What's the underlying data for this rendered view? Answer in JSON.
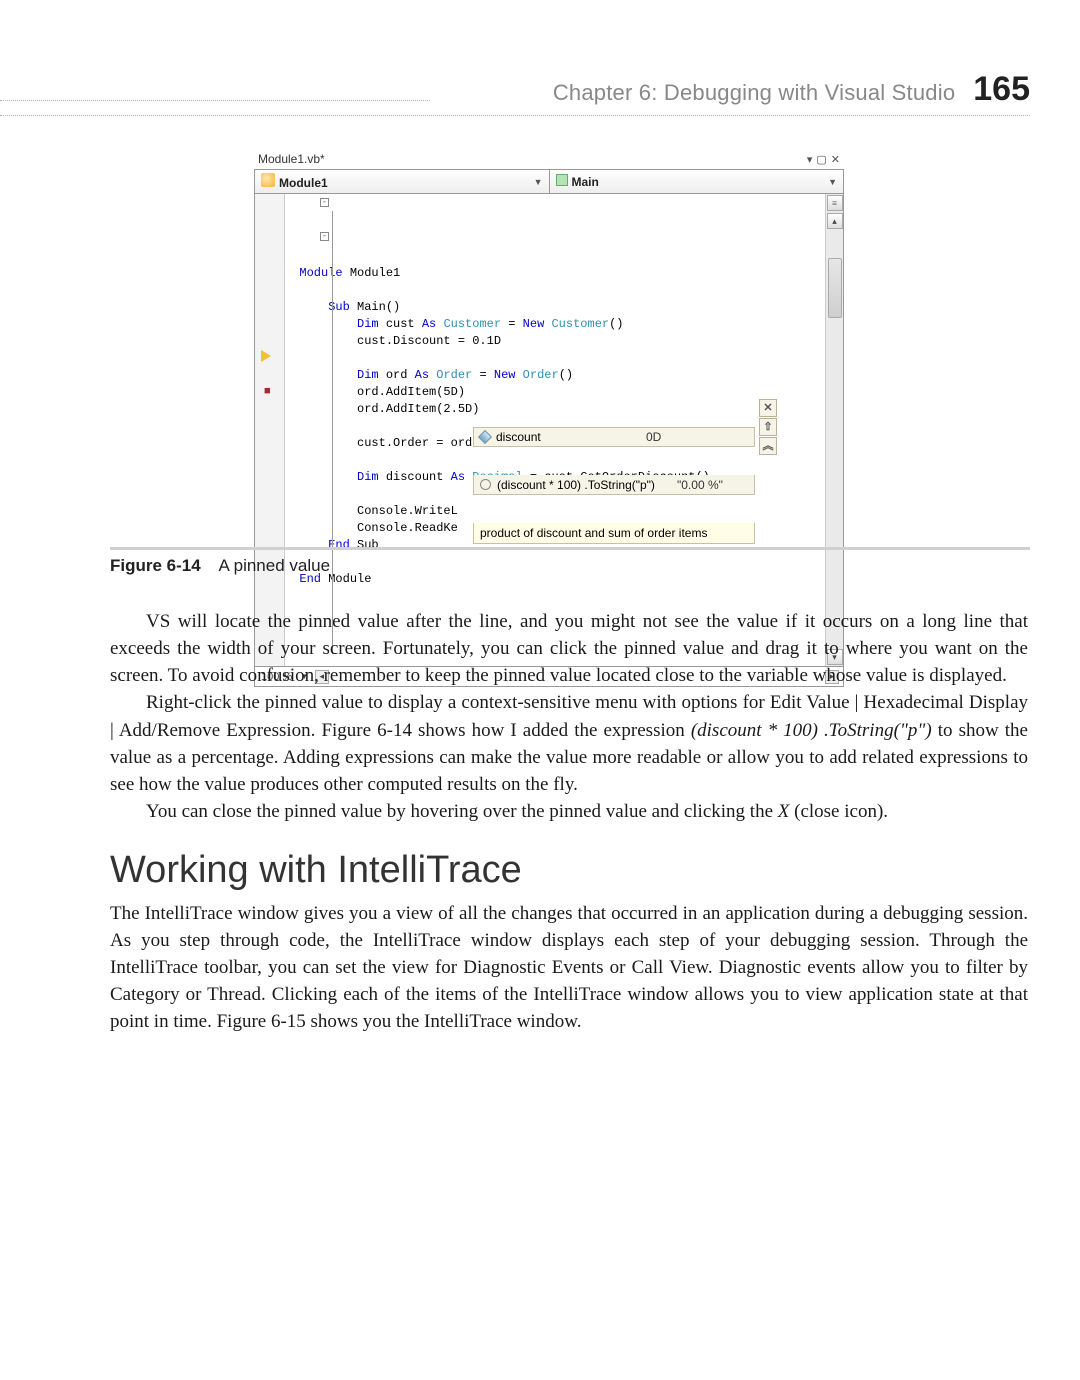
{
  "header": {
    "chapter": "Chapter 6:   Debugging with Visual Studio",
    "page_number": "165"
  },
  "vs": {
    "tab_title": "Module1.vb*",
    "combo_left": "Module1",
    "combo_right": "Main",
    "zoom": "100 %",
    "code": {
      "l1a": "Module",
      "l1b": " Module1",
      "l2a": "Sub",
      "l2b": " Main()",
      "l3a": "Dim",
      "l3b": " cust ",
      "l3c": "As",
      "l3d": " Customer",
      "l3e": " = ",
      "l3f": "New",
      "l3g": " Customer",
      "l3h": "()",
      "l4": "cust.Discount = 0.1D",
      "l5a": "Dim",
      "l5b": " ord ",
      "l5c": "As",
      "l5d": " Order",
      "l5e": " = ",
      "l5f": "New",
      "l5g": " Order",
      "l5h": "()",
      "l6": "ord.AddItem(5D)",
      "l7": "ord.AddItem(2.5D)",
      "l8": "cust.Order = ord",
      "l9a": "Dim",
      "l9b": " discount ",
      "l9c": "As",
      "l9d": " Decimal",
      "l9e": " = cust.GetOrderDiscount()",
      "l10": "Console.WriteL",
      "l11": "Console.ReadKe",
      "l12a": "End",
      "l12b": " Sub",
      "l13a": "End",
      "l13b": " Module"
    },
    "datatip": {
      "name1": "discount",
      "val1": "0D",
      "name2": "(discount * 100) .ToString(\"p\")",
      "val2": "\"0.00 %\"",
      "comment": "product of discount and sum of order items",
      "btn_close": "✕",
      "btn_pin": "⇧",
      "btn_expand": "︽"
    }
  },
  "figure": {
    "number": "Figure 6-14",
    "caption": "A pinned value"
  },
  "body": {
    "p1": "VS will locate the pinned value after the line, and you might not see the value if it occurs on a long line that exceeds the width of your screen. Fortunately, you can click the pinned value and drag it to where you want on the screen. To avoid confusion, remember to keep the pinned value located close to the variable whose value is displayed.",
    "p2a": "Right-click the pinned value to display a context-sensitive menu with options for Edit Value | Hexadecimal Display | Add/Remove Expression. Figure 6-14 shows how I added the expression ",
    "p2i": "(discount * 100) .ToString(\"p\")",
    "p2b": " to show the value as a percentage. Adding expressions can make the value more readable or allow you to add related expressions to see how the value produces other computed results on the fly.",
    "p3a": "You can close the pinned value by hovering over the pinned value and clicking the ",
    "p3i": "X",
    "p3b": " (close icon).",
    "h2": "Working with IntelliTrace",
    "p4": "The IntelliTrace window gives you a view of all the changes that occurred in an application during a debugging session. As you step through code, the IntelliTrace window displays each step of your debugging session. Through the IntelliTrace toolbar, you can set the view for Diagnostic Events or Call View. Diagnostic events allow you to filter by Category or Thread. Clicking each of the items of the IntelliTrace window allows you to view application state at that point in time. Figure 6-15 shows you the IntelliTrace window."
  }
}
